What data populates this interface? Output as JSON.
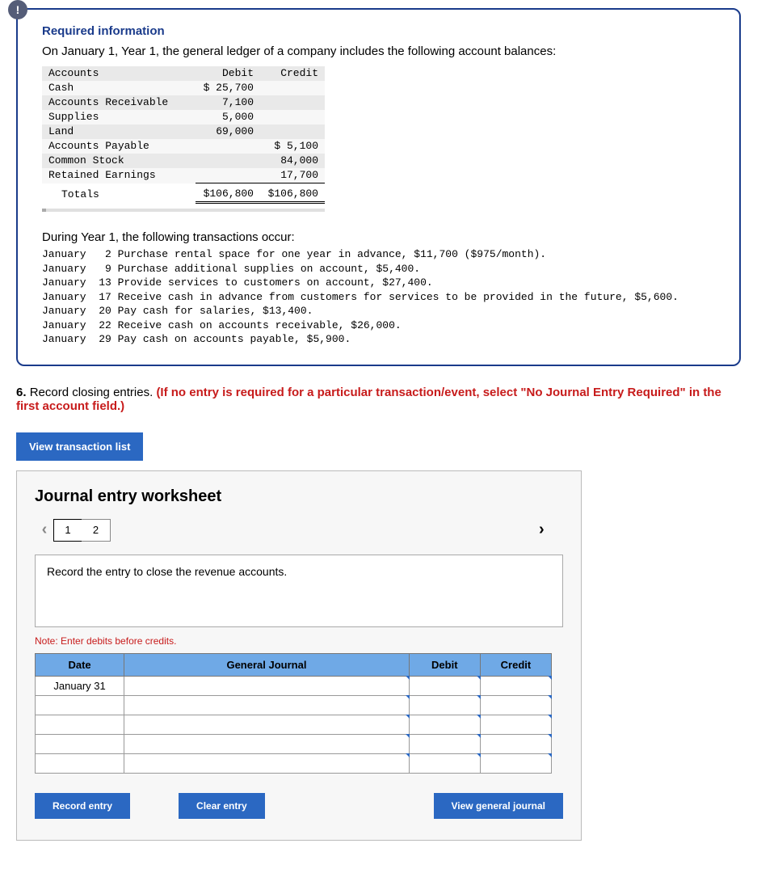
{
  "card": {
    "badge": "!",
    "title": "Required information",
    "intro": "On January 1, Year 1, the general ledger of a company includes the following account balances:",
    "ledger": {
      "headers": {
        "acct": "Accounts",
        "debit": "Debit",
        "credit": "Credit"
      },
      "rows": [
        {
          "acct": "Cash",
          "debit": "$ 25,700",
          "credit": ""
        },
        {
          "acct": "Accounts Receivable",
          "debit": "7,100",
          "credit": ""
        },
        {
          "acct": "Supplies",
          "debit": "5,000",
          "credit": ""
        },
        {
          "acct": "Land",
          "debit": "69,000",
          "credit": ""
        },
        {
          "acct": "Accounts Payable",
          "debit": "",
          "credit": "$  5,100"
        },
        {
          "acct": "Common Stock",
          "debit": "",
          "credit": "84,000"
        },
        {
          "acct": "Retained Earnings",
          "debit": "",
          "credit": "17,700"
        }
      ],
      "totals": {
        "label": "Totals",
        "debit": "$106,800",
        "credit": "$106,800"
      }
    },
    "trans_title": "During Year 1, the following transactions occur:",
    "trans_lines": "January   2 Purchase rental space for one year in advance, $11,700 ($975/month).\nJanuary   9 Purchase additional supplies on account, $5,400.\nJanuary  13 Provide services to customers on account, $27,400.\nJanuary  17 Receive cash in advance from customers for services to be provided in the future, $5,600.\nJanuary  20 Pay cash for salaries, $13,400.\nJanuary  22 Receive cash on accounts receivable, $26,000.\nJanuary  29 Pay cash on accounts payable, $5,900."
  },
  "question": {
    "num": "6.",
    "text": "Record closing entries.",
    "red": "(If no entry is required for a particular transaction/event, select \"No Journal Entry Required\" in the first account field.)"
  },
  "buttons": {
    "view_list": "View transaction list",
    "record": "Record entry",
    "clear": "Clear entry",
    "view_journal": "View general journal"
  },
  "worksheet": {
    "title": "Journal entry worksheet",
    "pages": [
      "1",
      "2"
    ],
    "active_page": "1",
    "instruction": "Record the entry to close the revenue accounts.",
    "note": "Note: Enter debits before credits.",
    "headers": {
      "date": "Date",
      "gj": "General Journal",
      "debit": "Debit",
      "credit": "Credit"
    },
    "date_value": "January 31"
  }
}
